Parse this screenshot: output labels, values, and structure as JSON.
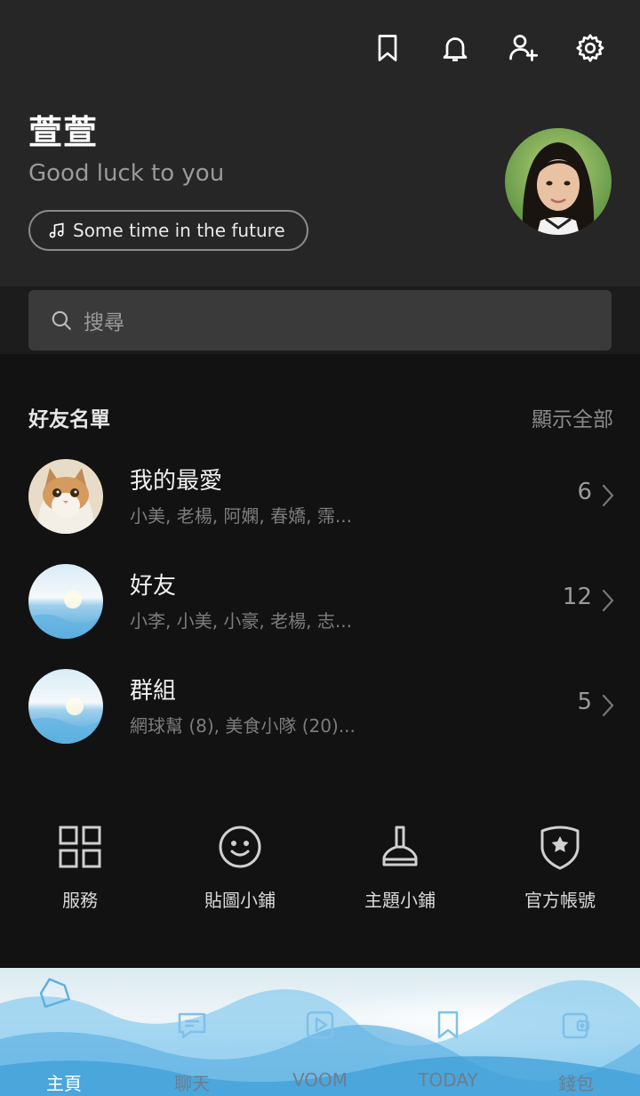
{
  "profile": {
    "name": "萱萱",
    "status_message": "Good luck to you",
    "music": "Some time in the future"
  },
  "search": {
    "placeholder": "搜尋"
  },
  "friends": {
    "title": "好友名單",
    "see_all": "顯示全部",
    "groups": [
      {
        "name": "我的最愛",
        "members": "小美, 老楊, 阿嫻, 春嬌, 霈...",
        "count": "6",
        "avatar": "cat-photo"
      },
      {
        "name": "好友",
        "members": "小李, 小美, 小豪, 老楊, 志...",
        "count": "12",
        "avatar": "ocean-photo"
      },
      {
        "name": "群組",
        "members": "網球幫 (8), 美食小隊 (20)...",
        "count": "5",
        "avatar": "ocean-photo"
      }
    ]
  },
  "services": [
    {
      "label": "服務",
      "icon": "grid-icon"
    },
    {
      "label": "貼圖小鋪",
      "icon": "smiley-icon"
    },
    {
      "label": "主題小鋪",
      "icon": "brush-icon"
    },
    {
      "label": "官方帳號",
      "icon": "shield-star-icon"
    }
  ],
  "tabs": [
    {
      "label": "主頁",
      "icon": "home-icon",
      "active": true
    },
    {
      "label": "聊天",
      "icon": "chat-icon",
      "active": false
    },
    {
      "label": "VOOM",
      "icon": "voom-play-icon",
      "active": false
    },
    {
      "label": "TODAY",
      "icon": "today-bookmark-icon",
      "active": false
    },
    {
      "label": "錢包",
      "icon": "wallet-icon",
      "active": false
    }
  ],
  "colors": {
    "background": "#121212",
    "header": "#262626",
    "search": "#3a3a3a",
    "tab_icon": "#7fc0ea"
  }
}
